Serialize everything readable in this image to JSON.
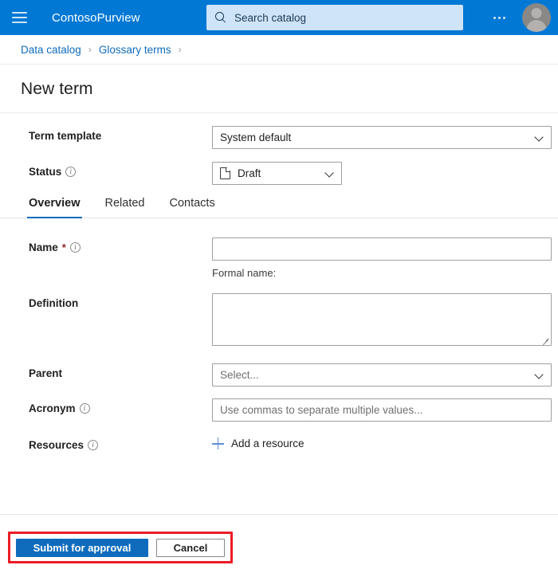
{
  "topbar": {
    "menu_icon": "hamburger-icon",
    "brand": "ContosoPurview",
    "search_placeholder": "Search catalog",
    "search_icon": "search-icon",
    "more_icon": "ellipsis-icon",
    "avatar_icon": "user-avatar-icon"
  },
  "breadcrumb": {
    "items": [
      {
        "label": "Data catalog"
      },
      {
        "label": "Glossary terms"
      }
    ],
    "separator": "›"
  },
  "page": {
    "title": "New term"
  },
  "form": {
    "term_template": {
      "label": "Term template",
      "value": "System default"
    },
    "status": {
      "label": "Status",
      "value": "Draft",
      "icon": "document-icon",
      "info_icon": "info-icon"
    },
    "name": {
      "label": "Name",
      "required_mark": "*",
      "value": "",
      "helper": "Formal name:",
      "info_icon": "info-icon"
    },
    "definition": {
      "label": "Definition",
      "value": ""
    },
    "parent": {
      "label": "Parent",
      "value": "Select..."
    },
    "acronym": {
      "label": "Acronym",
      "placeholder": "Use commas to separate multiple values...",
      "value": "",
      "info_icon": "info-icon"
    },
    "resources": {
      "label": "Resources",
      "add_label": "Add a resource",
      "add_icon": "plus-icon",
      "info_icon": "info-icon"
    }
  },
  "tabs": [
    {
      "label": "Overview",
      "active": true
    },
    {
      "label": "Related",
      "active": false
    },
    {
      "label": "Contacts",
      "active": false
    }
  ],
  "footer": {
    "submit_label": "Submit for approval",
    "cancel_label": "Cancel"
  },
  "colors": {
    "brand_blue": "#0078d4",
    "accent_blue": "#0f6cbd",
    "link_blue": "#0f6cbd",
    "search_bg": "#cfe4f7",
    "highlight_red": "#ec1c24",
    "required_red": "#8a2a22"
  }
}
